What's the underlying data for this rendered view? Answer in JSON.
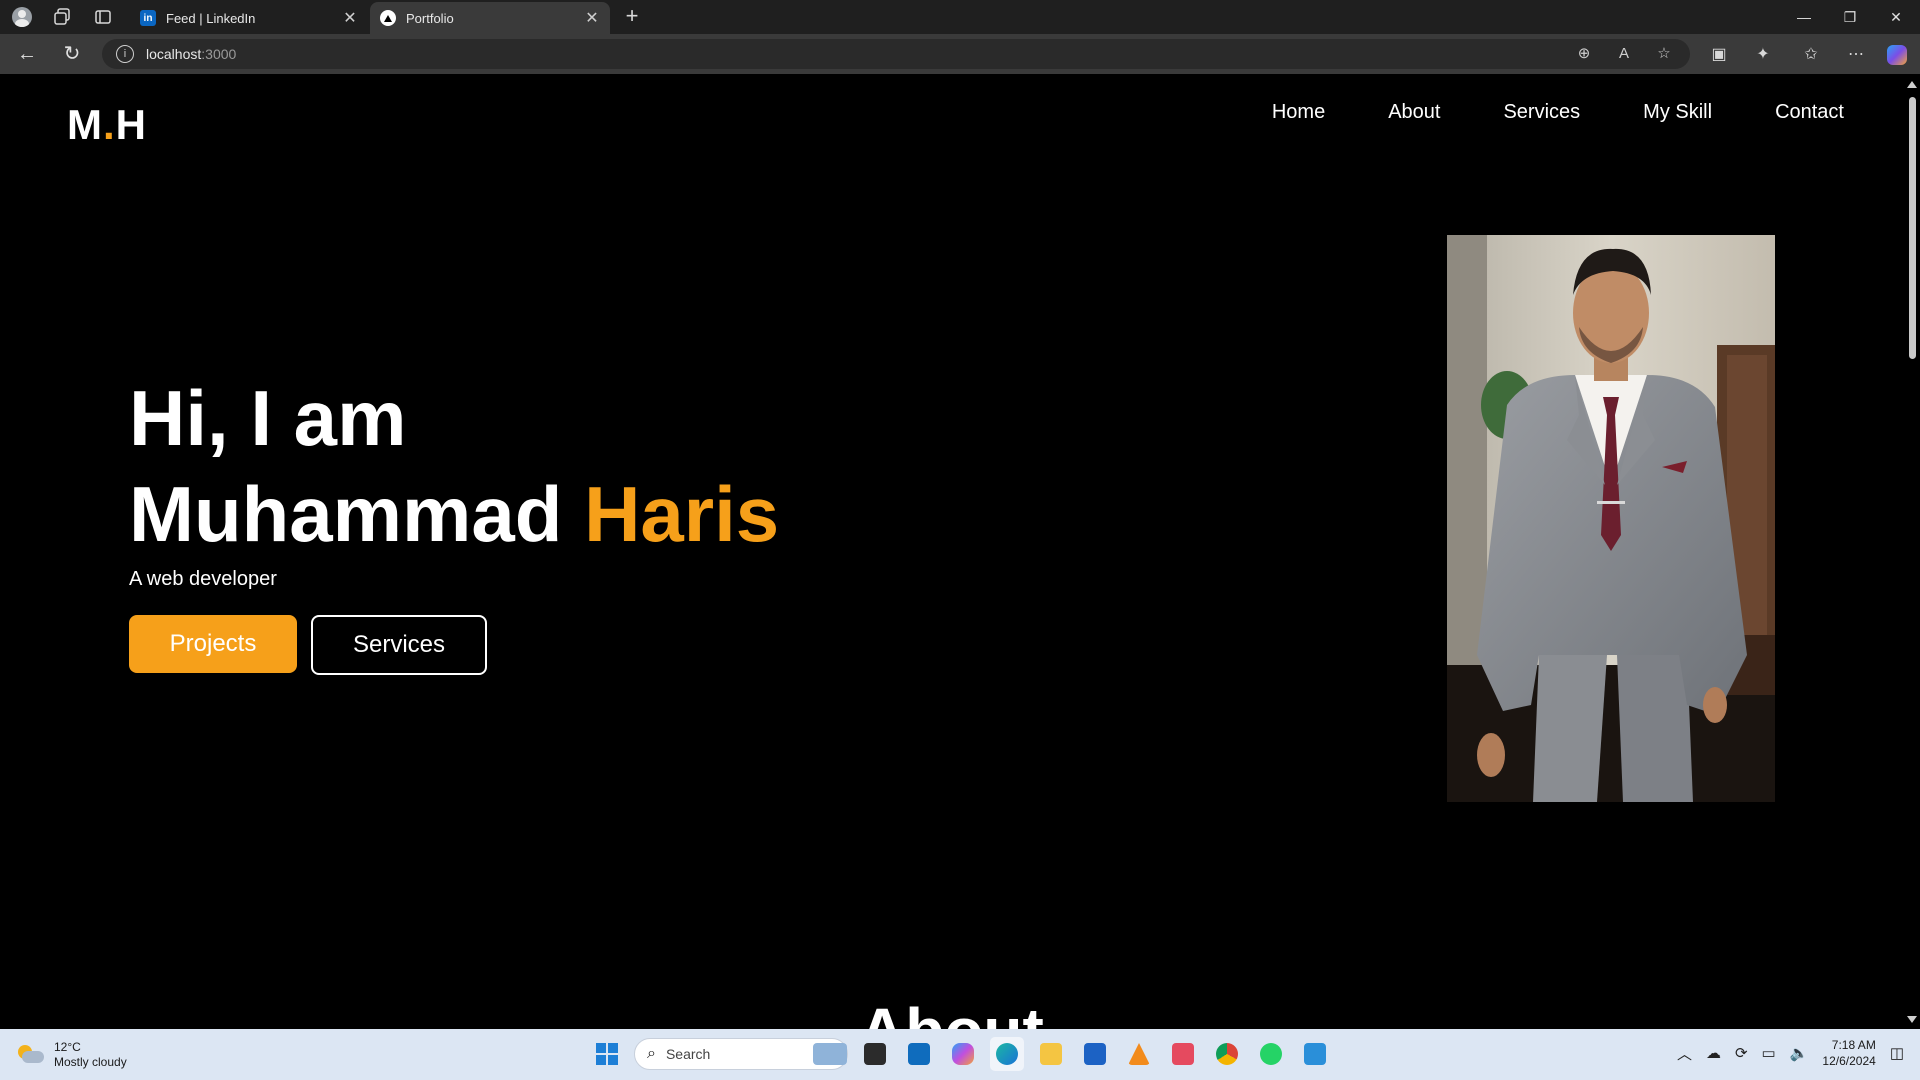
{
  "browser": {
    "tabs": [
      {
        "title": "Feed | LinkedIn",
        "favicon": "linkedin-icon",
        "active": false
      },
      {
        "title": "Portfolio",
        "favicon": "triangle-icon",
        "active": true
      }
    ],
    "address": {
      "host": "localhost",
      "port": ":3000"
    }
  },
  "page": {
    "logo": {
      "left": "M",
      "dot": ".",
      "right": "H"
    },
    "nav": [
      "Home",
      "About",
      "Services",
      "My Skill",
      "Contact"
    ],
    "hero": {
      "line1": "Hi, I am",
      "name_first": "Muhammad",
      "name_last": "Haris",
      "subtitle": "A web developer",
      "primary_button": "Projects",
      "secondary_button": "Services"
    },
    "next_section_heading": "About",
    "accent_color": "#f6a01a"
  },
  "taskbar": {
    "weather": {
      "temp": "12°C",
      "condition": "Mostly cloudy"
    },
    "search_placeholder": "Search",
    "clock": {
      "time": "7:18 AM",
      "date": "12/6/2024"
    }
  }
}
